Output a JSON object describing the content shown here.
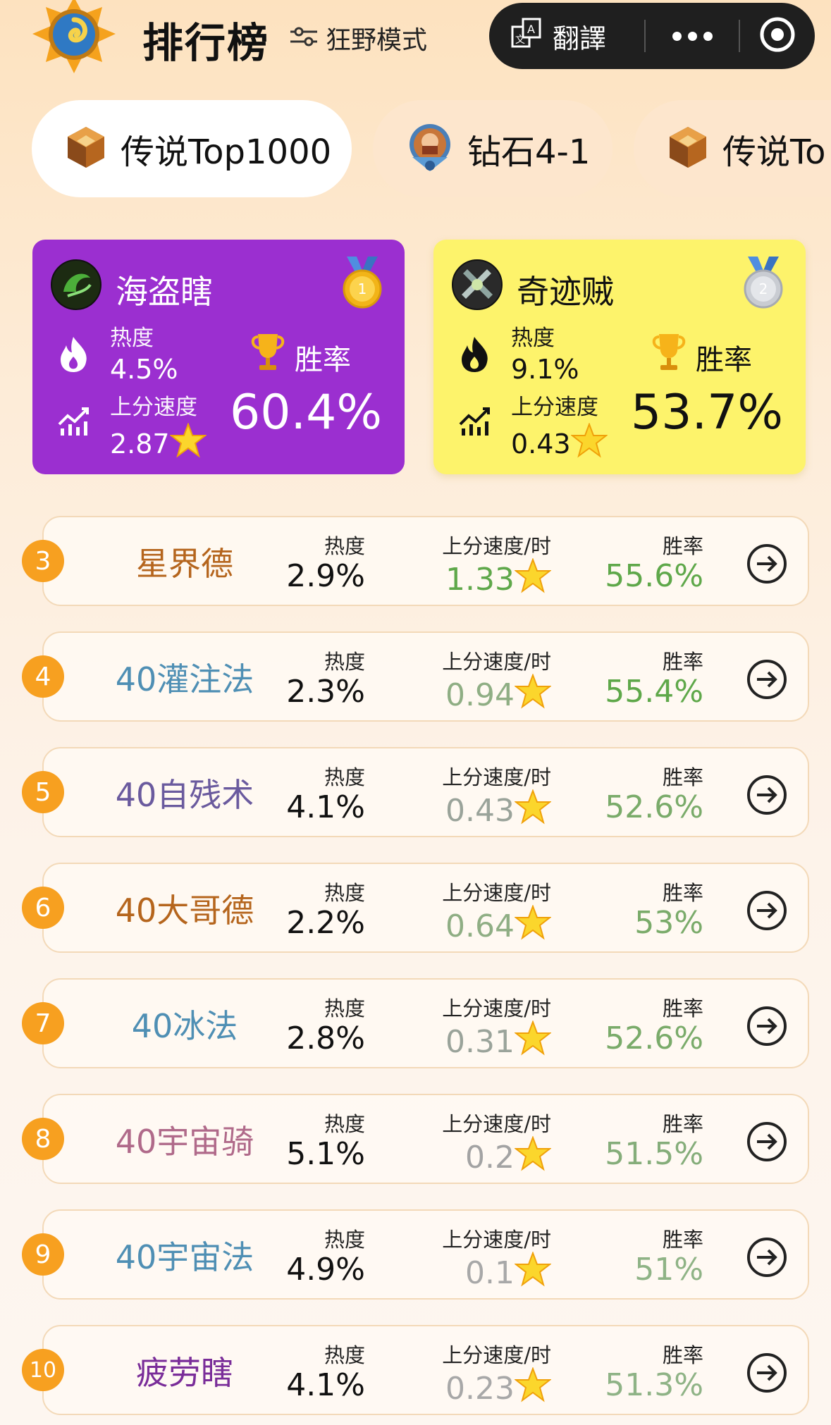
{
  "header": {
    "title": "排行榜",
    "mode_label": "狂野模式",
    "translate_label": "翻譯"
  },
  "tabs": [
    {
      "label": "传说Top1000",
      "active": true
    },
    {
      "label": "钻石4-1",
      "active": false
    },
    {
      "label": "传说To",
      "active": false
    }
  ],
  "top_cards": [
    {
      "name": "海盗瞎",
      "medal": "1",
      "hot_label": "热度",
      "hot": "4.5%",
      "speed_label": "上分速度",
      "speed": "2.87",
      "winrate_label": "胜率",
      "winrate": "60.4%"
    },
    {
      "name": "奇迹贼",
      "medal": "2",
      "hot_label": "热度",
      "hot": "9.1%",
      "speed_label": "上分速度",
      "speed": "0.43",
      "winrate_label": "胜率",
      "winrate": "53.7%"
    }
  ],
  "column_labels": {
    "hot": "热度",
    "speed": "上分速度/时",
    "winrate": "胜率"
  },
  "rows": [
    {
      "rank": "3",
      "name": "星界德",
      "hot": "2.9%",
      "speed": "1.33",
      "winrate": "55.6%"
    },
    {
      "rank": "4",
      "name": "40灌注法",
      "hot": "2.3%",
      "speed": "0.94",
      "winrate": "55.4%"
    },
    {
      "rank": "5",
      "name": "40自残术",
      "hot": "4.1%",
      "speed": "0.43",
      "winrate": "52.6%"
    },
    {
      "rank": "6",
      "name": "40大哥德",
      "hot": "2.2%",
      "speed": "0.64",
      "winrate": "53%"
    },
    {
      "rank": "7",
      "name": "40冰法",
      "hot": "2.8%",
      "speed": "0.31",
      "winrate": "52.6%"
    },
    {
      "rank": "8",
      "name": "40宇宙骑",
      "hot": "5.1%",
      "speed": "0.2",
      "winrate": "51.5%"
    },
    {
      "rank": "9",
      "name": "40宇宙法",
      "hot": "4.9%",
      "speed": "0.1",
      "winrate": "51%"
    },
    {
      "rank": "10",
      "name": "疲劳瞎",
      "hot": "4.1%",
      "speed": "0.23",
      "winrate": "51.3%"
    }
  ],
  "colors": {
    "druid": "#b5651d",
    "mage": "#4f8fb4",
    "warlock": "#6a5a9e",
    "paladin": "#b06a8a",
    "demon_hunter": "#7a2d99",
    "winrate_green": "#5fa84a",
    "rank_orange": "#f7a020",
    "card_purple": "#9b2fd0",
    "card_yellow": "#fdf36b"
  }
}
